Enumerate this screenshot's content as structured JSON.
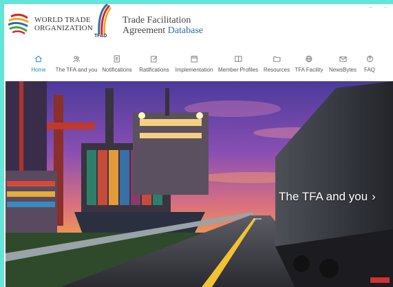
{
  "topbar": {
    "item1": "...",
    "item2": "..."
  },
  "logo": {
    "wto_line1": "WORLD TRADE",
    "wto_line2": "ORGANIZATION",
    "tfad_small": "TFAD",
    "title_line1": "Trade Facilitation",
    "title_line2_part1": "Agreement",
    "title_line2_part2": "Database"
  },
  "nav": [
    {
      "label": "Home",
      "icon": "home-icon",
      "active": true
    },
    {
      "label": "The TFA and you",
      "icon": "people-icon"
    },
    {
      "label": "Notifications",
      "icon": "notification-icon"
    },
    {
      "label": "Ratifications",
      "icon": "edit-icon"
    },
    {
      "label": "Implementation",
      "icon": "calendar-icon"
    },
    {
      "label": "Member Profiles",
      "icon": "book-icon"
    },
    {
      "label": "Resources",
      "icon": "folder-icon"
    },
    {
      "label": "TFA Facility",
      "icon": "globe-icon"
    },
    {
      "label": "NewsBytes",
      "icon": "mail-icon"
    },
    {
      "label": "FAQ",
      "icon": "question-icon"
    }
  ],
  "hero": {
    "link_text": "The TFA and you",
    "chevron": "›"
  },
  "colors": {
    "accent": "#1e88c7",
    "frame": "#63e6d8"
  }
}
